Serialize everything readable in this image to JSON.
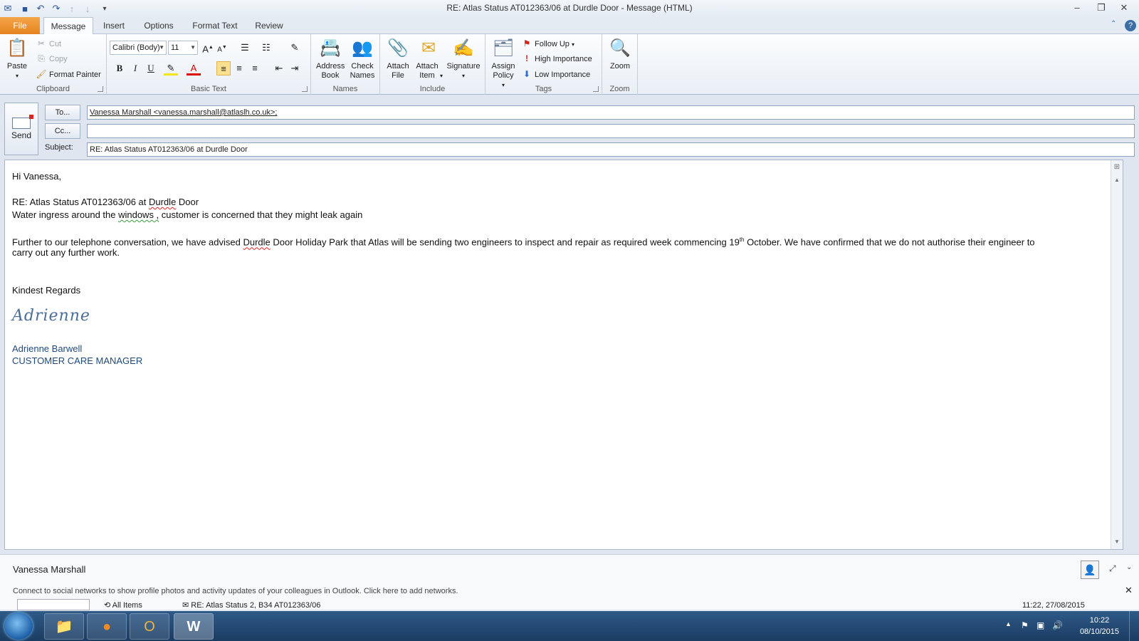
{
  "window": {
    "title": "RE: Atlas Status AT012363/06 at Durdle Door  -  Message (HTML)"
  },
  "tabs": [
    {
      "label": "File"
    },
    {
      "label": "Message"
    },
    {
      "label": "Insert"
    },
    {
      "label": "Options"
    },
    {
      "label": "Format Text"
    },
    {
      "label": "Review"
    }
  ],
  "ribbon": {
    "clipboard": {
      "label": "Clipboard",
      "paste": "Paste",
      "cut": "Cut",
      "copy": "Copy",
      "format_painter": "Format Painter"
    },
    "basic_text": {
      "label": "Basic Text",
      "font": "Calibri (Body)",
      "font_size": "11",
      "bold": "B",
      "italic": "I",
      "underline": "U",
      "grow": "A",
      "shrink": "A"
    },
    "names": {
      "label": "Names",
      "address_book": "Address Book",
      "check_names": "Check Names"
    },
    "include": {
      "label": "Include",
      "attach_file": "Attach File",
      "attach_item": "Attach Item",
      "signature": "Signature"
    },
    "tags": {
      "label": "Tags",
      "assign_policy": "Assign Policy",
      "follow_up": "Follow Up",
      "high_importance": "High Importance",
      "low_importance": "Low Importance"
    },
    "zoom": {
      "label": "Zoom",
      "zoom": "Zoom"
    }
  },
  "header": {
    "send": "Send",
    "to_button": "To...",
    "cc_button": "Cc...",
    "subject_label": "Subject:",
    "to_value": "Vanessa Marshall <vanessa.marshall@atlaslh.co.uk>;",
    "cc_value": "",
    "subject_value": "RE: Atlas Status AT012363/06 at Durdle Door"
  },
  "body": {
    "greeting": "Hi Vanessa,",
    "re_prefix": "RE: Atlas Status AT012363/06 at ",
    "re_word": "Durdle",
    "re_suffix": " Door",
    "line2_a": "Water ingress around the ",
    "line2_b": "windows ,",
    "line2_c": " customer is concerned that they might leak again",
    "para_a": "Further to our telephone conversation, we have advised ",
    "para_word": "Durdle",
    "para_b": " Door Holiday Park that Atlas will be sending two engineers to inspect and repair as required week commencing 19",
    "para_sup": "th",
    "para_c": " October.  We have confirmed that we do not authorise their engineer to",
    "para_line2": "carry out any further work.",
    "closing": "Kindest Regards",
    "signature_script": "Adrienne",
    "sig_name": "Adrienne Barwell",
    "sig_title": "CUSTOMER CARE MANAGER"
  },
  "people_pane": {
    "name": "Vanessa Marshall",
    "message": "Connect to social networks to show profile photos and activity updates of your colleagues in Outlook. Click here to add networks.",
    "all_items": "All Items",
    "item_subject": "RE: Atlas Status 2, B34 AT012363/06",
    "item_time": "11:22, 27/08/2015"
  },
  "taskbar": {
    "time": "10:22",
    "date": "08/10/2015"
  },
  "colors": {
    "file_tab": "#e5831e",
    "signature_blue": "#1f497d",
    "taskbar": "#1b3c62"
  }
}
